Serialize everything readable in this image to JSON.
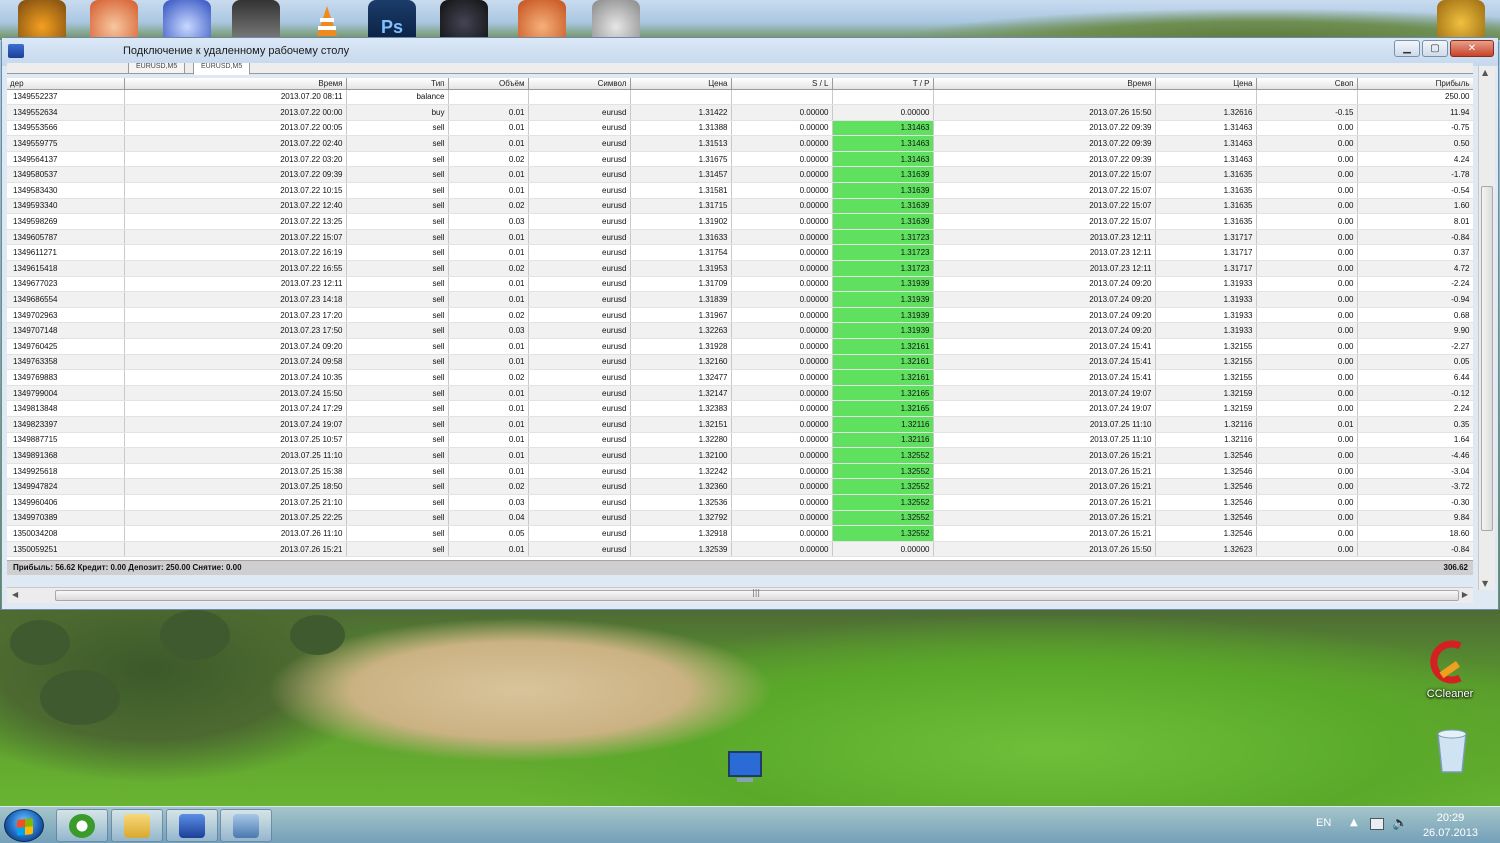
{
  "window": {
    "title": "Подключение к удаленному рабочему столу",
    "tabs": [
      "EURUSD,M5",
      "EURUSD,M5"
    ]
  },
  "table": {
    "headers": [
      "дер",
      "Время",
      "Тип",
      "Объём",
      "Символ",
      "Цена",
      "S / L",
      "T / P",
      "Время",
      "Цена",
      "Своп",
      "Прибыль"
    ],
    "rows": [
      [
        "1349552237",
        "2013.07.20 08:11",
        "balance",
        "",
        "",
        "",
        "",
        "",
        "",
        "",
        "",
        "250.00"
      ],
      [
        "1349552634",
        "2013.07.22 00:00",
        "buy",
        "0.01",
        "eurusd",
        "1.31422",
        "0.00000",
        "0.00000",
        "2013.07.26 15:50",
        "1.32616",
        "-0.15",
        "11.94"
      ],
      [
        "1349553566",
        "2013.07.22 00:05",
        "sell",
        "0.01",
        "eurusd",
        "1.31388",
        "0.00000",
        "1.31463",
        "2013.07.22 09:39",
        "1.31463",
        "0.00",
        "-0.75"
      ],
      [
        "1349559775",
        "2013.07.22 02:40",
        "sell",
        "0.01",
        "eurusd",
        "1.31513",
        "0.00000",
        "1.31463",
        "2013.07.22 09:39",
        "1.31463",
        "0.00",
        "0.50"
      ],
      [
        "1349564137",
        "2013.07.22 03:20",
        "sell",
        "0.02",
        "eurusd",
        "1.31675",
        "0.00000",
        "1.31463",
        "2013.07.22 09:39",
        "1.31463",
        "0.00",
        "4.24"
      ],
      [
        "1349580537",
        "2013.07.22 09:39",
        "sell",
        "0.01",
        "eurusd",
        "1.31457",
        "0.00000",
        "1.31639",
        "2013.07.22 15:07",
        "1.31635",
        "0.00",
        "-1.78"
      ],
      [
        "1349583430",
        "2013.07.22 10:15",
        "sell",
        "0.01",
        "eurusd",
        "1.31581",
        "0.00000",
        "1.31639",
        "2013.07.22 15:07",
        "1.31635",
        "0.00",
        "-0.54"
      ],
      [
        "1349593340",
        "2013.07.22 12:40",
        "sell",
        "0.02",
        "eurusd",
        "1.31715",
        "0.00000",
        "1.31639",
        "2013.07.22 15:07",
        "1.31635",
        "0.00",
        "1.60"
      ],
      [
        "1349598269",
        "2013.07.22 13:25",
        "sell",
        "0.03",
        "eurusd",
        "1.31902",
        "0.00000",
        "1.31639",
        "2013.07.22 15:07",
        "1.31635",
        "0.00",
        "8.01"
      ],
      [
        "1349605787",
        "2013.07.22 15:07",
        "sell",
        "0.01",
        "eurusd",
        "1.31633",
        "0.00000",
        "1.31723",
        "2013.07.23 12:11",
        "1.31717",
        "0.00",
        "-0.84"
      ],
      [
        "1349611271",
        "2013.07.22 16:19",
        "sell",
        "0.01",
        "eurusd",
        "1.31754",
        "0.00000",
        "1.31723",
        "2013.07.23 12:11",
        "1.31717",
        "0.00",
        "0.37"
      ],
      [
        "1349615418",
        "2013.07.22 16:55",
        "sell",
        "0.02",
        "eurusd",
        "1.31953",
        "0.00000",
        "1.31723",
        "2013.07.23 12:11",
        "1.31717",
        "0.00",
        "4.72"
      ],
      [
        "1349677023",
        "2013.07.23 12:11",
        "sell",
        "0.01",
        "eurusd",
        "1.31709",
        "0.00000",
        "1.31939",
        "2013.07.24 09:20",
        "1.31933",
        "0.00",
        "-2.24"
      ],
      [
        "1349686554",
        "2013.07.23 14:18",
        "sell",
        "0.01",
        "eurusd",
        "1.31839",
        "0.00000",
        "1.31939",
        "2013.07.24 09:20",
        "1.31933",
        "0.00",
        "-0.94"
      ],
      [
        "1349702963",
        "2013.07.23 17:20",
        "sell",
        "0.02",
        "eurusd",
        "1.31967",
        "0.00000",
        "1.31939",
        "2013.07.24 09:20",
        "1.31933",
        "0.00",
        "0.68"
      ],
      [
        "1349707148",
        "2013.07.23 17:50",
        "sell",
        "0.03",
        "eurusd",
        "1.32263",
        "0.00000",
        "1.31939",
        "2013.07.24 09:20",
        "1.31933",
        "0.00",
        "9.90"
      ],
      [
        "1349760425",
        "2013.07.24 09:20",
        "sell",
        "0.01",
        "eurusd",
        "1.31928",
        "0.00000",
        "1.32161",
        "2013.07.24 15:41",
        "1.32155",
        "0.00",
        "-2.27"
      ],
      [
        "1349763358",
        "2013.07.24 09:58",
        "sell",
        "0.01",
        "eurusd",
        "1.32160",
        "0.00000",
        "1.32161",
        "2013.07.24 15:41",
        "1.32155",
        "0.00",
        "0.05"
      ],
      [
        "1349769883",
        "2013.07.24 10:35",
        "sell",
        "0.02",
        "eurusd",
        "1.32477",
        "0.00000",
        "1.32161",
        "2013.07.24 15:41",
        "1.32155",
        "0.00",
        "6.44"
      ],
      [
        "1349799004",
        "2013.07.24 15:50",
        "sell",
        "0.01",
        "eurusd",
        "1.32147",
        "0.00000",
        "1.32165",
        "2013.07.24 19:07",
        "1.32159",
        "0.00",
        "-0.12"
      ],
      [
        "1349813848",
        "2013.07.24 17:29",
        "sell",
        "0.01",
        "eurusd",
        "1.32383",
        "0.00000",
        "1.32165",
        "2013.07.24 19:07",
        "1.32159",
        "0.00",
        "2.24"
      ],
      [
        "1349823397",
        "2013.07.24 19:07",
        "sell",
        "0.01",
        "eurusd",
        "1.32151",
        "0.00000",
        "1.32116",
        "2013.07.25 11:10",
        "1.32116",
        "0.01",
        "0.35"
      ],
      [
        "1349887715",
        "2013.07.25 10:57",
        "sell",
        "0.01",
        "eurusd",
        "1.32280",
        "0.00000",
        "1.32116",
        "2013.07.25 11:10",
        "1.32116",
        "0.00",
        "1.64"
      ],
      [
        "1349891368",
        "2013.07.25 11:10",
        "sell",
        "0.01",
        "eurusd",
        "1.32100",
        "0.00000",
        "1.32552",
        "2013.07.26 15:21",
        "1.32546",
        "0.00",
        "-4.46"
      ],
      [
        "1349925618",
        "2013.07.25 15:38",
        "sell",
        "0.01",
        "eurusd",
        "1.32242",
        "0.00000",
        "1.32552",
        "2013.07.26 15:21",
        "1.32546",
        "0.00",
        "-3.04"
      ],
      [
        "1349947824",
        "2013.07.25 18:50",
        "sell",
        "0.02",
        "eurusd",
        "1.32360",
        "0.00000",
        "1.32552",
        "2013.07.26 15:21",
        "1.32546",
        "0.00",
        "-3.72"
      ],
      [
        "1349960406",
        "2013.07.25 21:10",
        "sell",
        "0.03",
        "eurusd",
        "1.32536",
        "0.00000",
        "1.32552",
        "2013.07.26 15:21",
        "1.32546",
        "0.00",
        "-0.30"
      ],
      [
        "1349970389",
        "2013.07.25 22:25",
        "sell",
        "0.04",
        "eurusd",
        "1.32792",
        "0.00000",
        "1.32552",
        "2013.07.26 15:21",
        "1.32546",
        "0.00",
        "9.84"
      ],
      [
        "1350034208",
        "2013.07.26 11:10",
        "sell",
        "0.05",
        "eurusd",
        "1.32918",
        "0.00000",
        "1.32552",
        "2013.07.26 15:21",
        "1.32546",
        "0.00",
        "18.60"
      ],
      [
        "1350059251",
        "2013.07.26 15:21",
        "sell",
        "0.01",
        "eurusd",
        "1.32539",
        "0.00000",
        "0.00000",
        "2013.07.26 15:50",
        "1.32623",
        "0.00",
        "-0.84"
      ]
    ]
  },
  "summary": {
    "text": "Прибыль: 56.62  Кредит: 0.00  Депозит: 250.00  Снятие: 0.00",
    "total": "306.62"
  },
  "desktop": {
    "icons": [
      {
        "name": "ccleaner-icon",
        "label": "CCleaner"
      },
      {
        "name": "recycle-bin-icon",
        "label": ""
      },
      {
        "name": "remote-desktop-icon",
        "label": ""
      }
    ]
  },
  "tray": {
    "language": "EN",
    "time": "20:29",
    "date": "26.07.2013"
  },
  "colors": {
    "tp_highlight": "#5fe15f",
    "titlebar": "#c5d8ee",
    "taskbar": "#7aa0c8"
  }
}
